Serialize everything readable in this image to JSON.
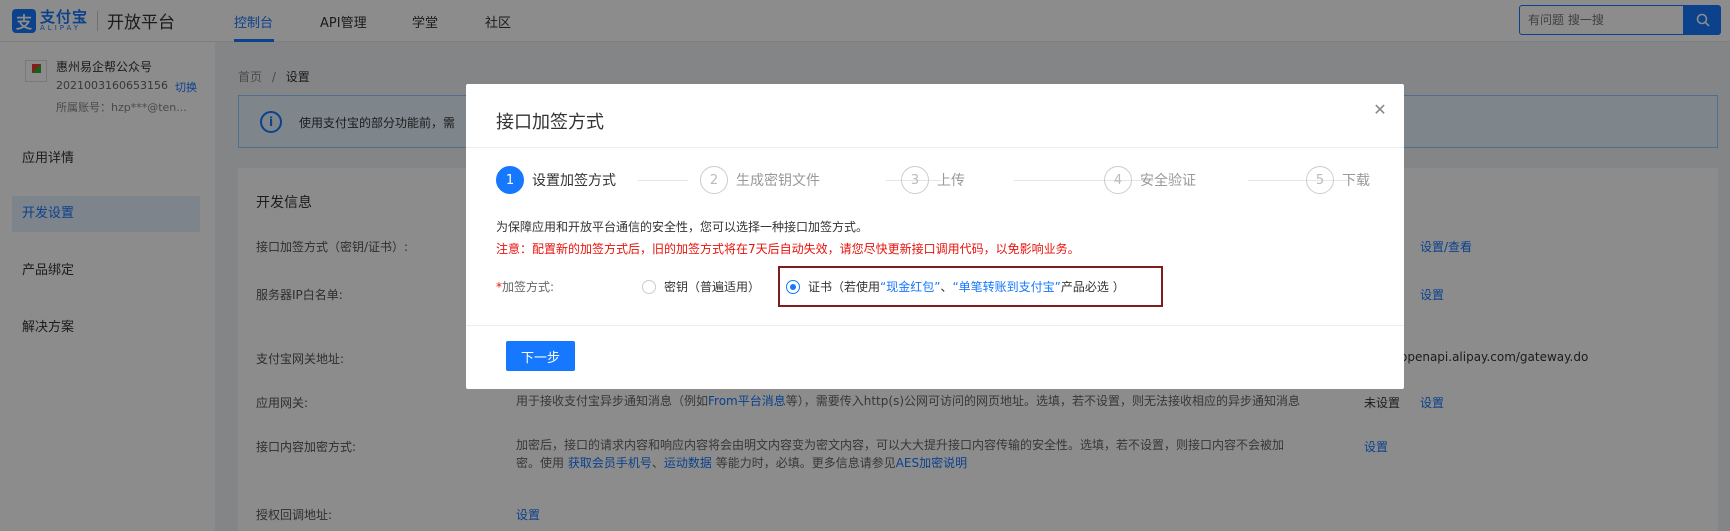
{
  "header": {
    "logo_cn": "支付宝",
    "logo_en": "ALIPAY",
    "platform": "开放平台",
    "nav": [
      {
        "label": "控制台",
        "active": true
      },
      {
        "label": "API管理",
        "active": false
      },
      {
        "label": "学堂",
        "active": false
      },
      {
        "label": "社区",
        "active": false
      }
    ],
    "search_placeholder": "有问题 搜一搜",
    "accent": "#1677ff"
  },
  "sidebar": {
    "app_name": "惠州易企帮公众号",
    "app_id": "2021003160653156",
    "switch_label": "切换",
    "account": "所属账号：hzp***@ten...",
    "items": [
      {
        "label": "应用详情",
        "active": false
      },
      {
        "label": "开发设置",
        "active": true
      },
      {
        "label": "产品绑定",
        "active": false
      },
      {
        "label": "解决方案",
        "active": false
      }
    ]
  },
  "main": {
    "breadcrumb": {
      "home": "首页",
      "sep": "/",
      "current": "设置"
    },
    "notice_text": "使用支付宝的部分功能前，需",
    "section_title": "开发信息",
    "rows": {
      "sign_label": "接口加签方式（密钥/证书）:",
      "sign_link": "设置/查看",
      "ip_label": "服务器IP白名单:",
      "ip_link": "设置",
      "gateway_label": "支付宝网关地址:",
      "gateway_value": "openapi.alipay.com/gateway.do",
      "appgw_label": "应用网关:",
      "appgw_desc_a": "用于接收支付宝异步通知消息（例如",
      "appgw_desc_link": "From平台消息",
      "appgw_desc_b": "等），需要传入http(s)公网可访问的网页地址。选填，若不设置，则无法接收相应的异步通知消息",
      "appgw_status": "未设置",
      "appgw_link": "设置",
      "enc_label": "接口内容加密方式:",
      "enc_desc_1": "加密后，接口的请求内容和响应内容将会由明文内容变为密文内容，可以大大提升接口内容传输的安全性。选填，若不设置，则接口内容不会被加",
      "enc_desc_2a": "密。使用 ",
      "enc_desc_link1": "获取会员手机号",
      "enc_desc_sep": "、",
      "enc_desc_link2": "运动数据",
      "enc_desc_2b": " 等能力时，必填。更多信息请参见",
      "enc_desc_link3": "AES加密说明",
      "enc_link": "设置",
      "auth_label": "授权回调地址:",
      "auth_link": "设置"
    }
  },
  "modal": {
    "title": "接口加签方式",
    "close_icon": "close-icon",
    "steps": [
      {
        "num": "1",
        "label": "设置加签方式",
        "active": true
      },
      {
        "num": "2",
        "label": "生成密钥文件",
        "active": false
      },
      {
        "num": "3",
        "label": "上传",
        "active": false
      },
      {
        "num": "4",
        "label": "安全验证",
        "active": false
      },
      {
        "num": "5",
        "label": "下载",
        "active": false
      }
    ],
    "desc": "为保障应用和开放平台通信的安全性，您可以选择一种接口加签方式。",
    "warning": "注意：配置新的加签方式后，旧的加签方式将在7天后自动失效，请您尽快更新接口调用代码，以免影响业务。",
    "field_required": "*",
    "field_label": "加签方式:",
    "option_key": "密钥（普遍适用）",
    "option_cert_a": "证书（若使用",
    "option_cert_link1": "“现金红包”",
    "option_cert_sep": "、",
    "option_cert_link2": "“单笔转账到支付宝”",
    "option_cert_b": "产品必选 ）",
    "selected": "cert",
    "next_button": "下一步",
    "highlight_color": "#7f1d1d",
    "warning_color": "#e8120c"
  }
}
